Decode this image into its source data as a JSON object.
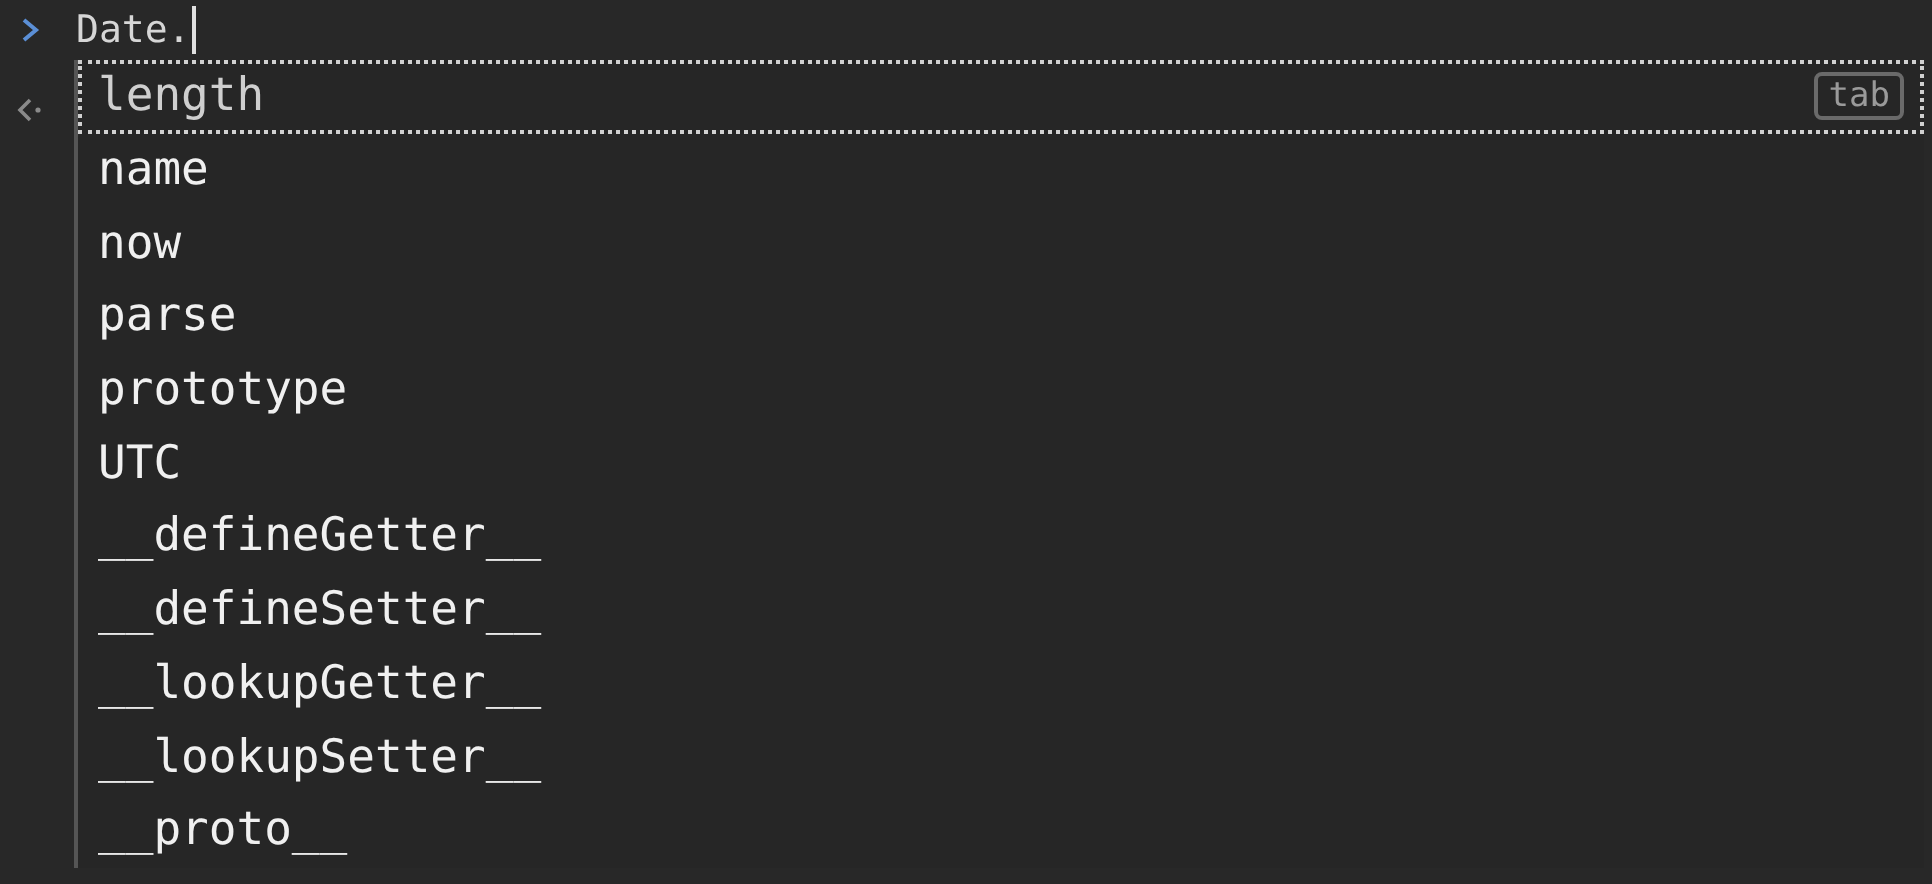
{
  "prompt": {
    "input": "Date."
  },
  "suggestions": [
    {
      "label": "length",
      "selected": true,
      "hint": "tab"
    },
    {
      "label": "name",
      "selected": false
    },
    {
      "label": "now",
      "selected": false
    },
    {
      "label": "parse",
      "selected": false
    },
    {
      "label": "prototype",
      "selected": false
    },
    {
      "label": "UTC",
      "selected": false
    },
    {
      "label": "__defineGetter__",
      "selected": false
    },
    {
      "label": "__defineSetter__",
      "selected": false
    },
    {
      "label": "__lookupGetter__",
      "selected": false
    },
    {
      "label": "__lookupSetter__",
      "selected": false
    },
    {
      "label": "__proto__",
      "selected": false
    }
  ]
}
